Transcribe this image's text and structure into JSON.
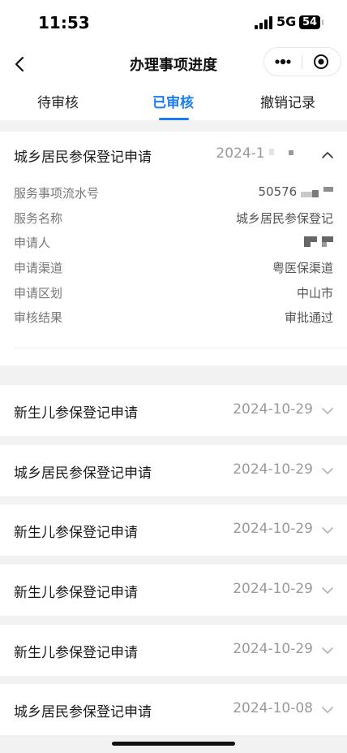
{
  "status_bar": {
    "time": "11:53",
    "network": "5G",
    "battery": "54"
  },
  "nav": {
    "title": "办理事项进度",
    "back_icon": "chevron-left-icon",
    "more_icon": "more-dots-icon",
    "close_icon": "target-close-icon"
  },
  "tabs": [
    {
      "label": "待审核",
      "active": false
    },
    {
      "label": "已审核",
      "active": true
    },
    {
      "label": "撤销记录",
      "active": false
    }
  ],
  "expanded_item": {
    "title": "城乡居民参保登记申请",
    "date": "2024-1",
    "details": [
      {
        "label": "服务事项流水号",
        "value": "50576"
      },
      {
        "label": "服务名称",
        "value": "城乡居民参保登记"
      },
      {
        "label": "申请人",
        "value": ""
      },
      {
        "label": "申请渠道",
        "value": "粤医保渠道"
      },
      {
        "label": "申请区划",
        "value": "中山市"
      },
      {
        "label": "审核结果",
        "value": "审批通过"
      }
    ]
  },
  "items": [
    {
      "title": "新生儿参保登记申请",
      "date": "2024-10-29"
    },
    {
      "title": "城乡居民参保登记申请",
      "date": "2024-10-29"
    },
    {
      "title": "新生儿参保登记申请",
      "date": "2024-10-29"
    },
    {
      "title": "新生儿参保登记申请",
      "date": "2024-10-29"
    },
    {
      "title": "新生儿参保登记申请",
      "date": "2024-10-29"
    },
    {
      "title": "城乡居民参保登记申请",
      "date": "2024-10-08"
    }
  ],
  "colors": {
    "accent": "#1d7cf2",
    "background": "#f2f2f2",
    "muted": "#9a9a9a"
  }
}
